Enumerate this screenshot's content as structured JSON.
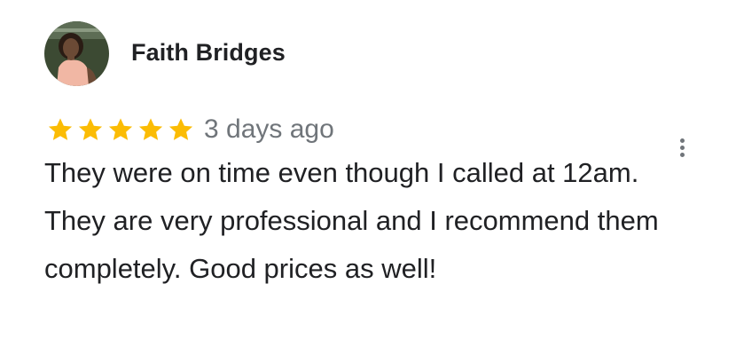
{
  "review": {
    "author_name": "Faith Bridges",
    "rating": 5,
    "max_rating": 5,
    "date": "3 days ago",
    "text": "They were on time even though I called at 12am. They are very professional and I recommend them completely. Good prices as well!"
  },
  "icons": {
    "star": "star-icon",
    "more": "more-vert-icon"
  },
  "colors": {
    "star": "#fbbc04",
    "author": "#202124",
    "date": "#70757a",
    "text": "#202124",
    "menu_dots": "#70757a"
  }
}
